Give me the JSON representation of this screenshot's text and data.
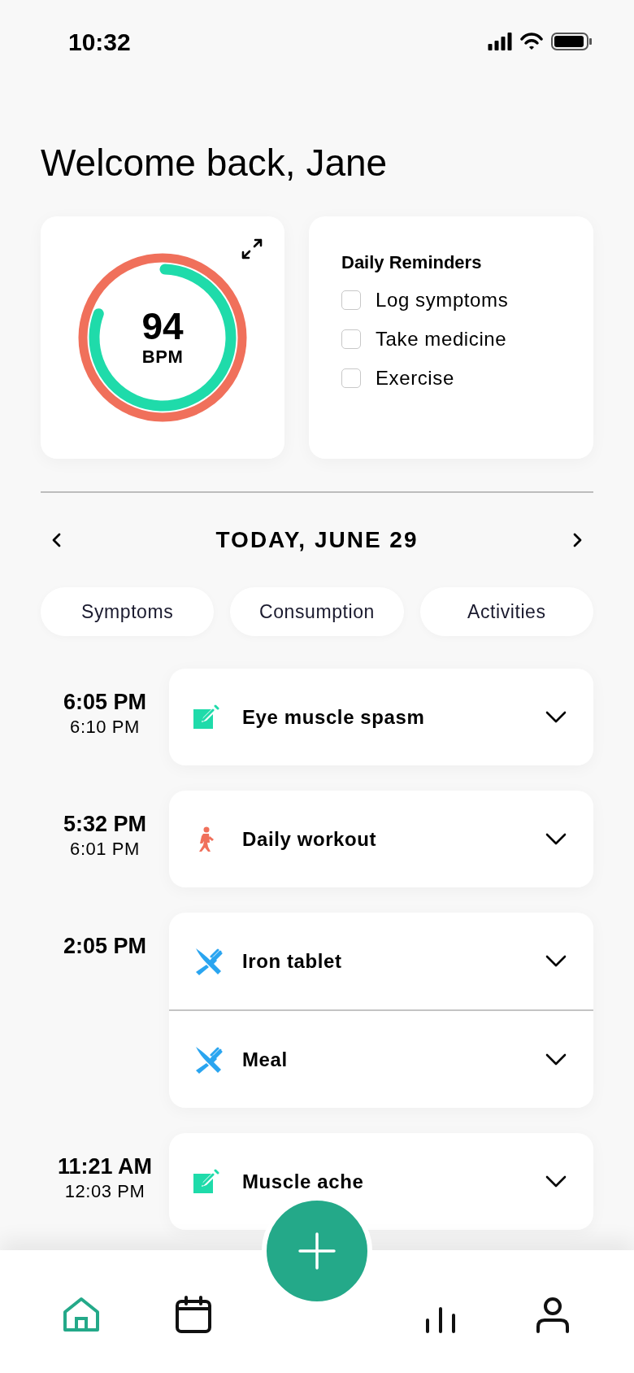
{
  "status_bar": {
    "time": "10:32"
  },
  "greeting": "Welcome back, Jane",
  "heart_rate": {
    "value": "94",
    "unit": "BPM",
    "level": 0.8
  },
  "reminders": {
    "title": "Daily Reminders",
    "items": [
      {
        "label": "Log symptoms",
        "checked": false
      },
      {
        "label": "Take medicine",
        "checked": false
      },
      {
        "label": "Exercise",
        "checked": false
      }
    ]
  },
  "date_nav": {
    "label": "TODAY, JUNE 29"
  },
  "filters": [
    "Symptoms",
    "Consumption",
    "Activities"
  ],
  "timeline": [
    {
      "start": "6:05 PM",
      "end": "6:10 PM",
      "entries": [
        {
          "kind": "symptom",
          "title": "Eye muscle spasm"
        }
      ]
    },
    {
      "start": "5:32 PM",
      "end": "6:01 PM",
      "entries": [
        {
          "kind": "activity",
          "title": "Daily workout"
        }
      ]
    },
    {
      "start": "2:05 PM",
      "entries": [
        {
          "kind": "consumption",
          "title": "Iron tablet"
        },
        {
          "kind": "consumption",
          "title": "Meal"
        }
      ]
    },
    {
      "start": "11:21 AM",
      "end": "12:03 PM",
      "entries": [
        {
          "kind": "symptom",
          "title": "Muscle ache"
        }
      ]
    }
  ],
  "bottom_nav": [
    {
      "kind": "home",
      "selected": true
    },
    {
      "kind": "calendar",
      "selected": false
    },
    {
      "kind": "stats",
      "selected": false
    },
    {
      "kind": "profile",
      "selected": false
    }
  ]
}
